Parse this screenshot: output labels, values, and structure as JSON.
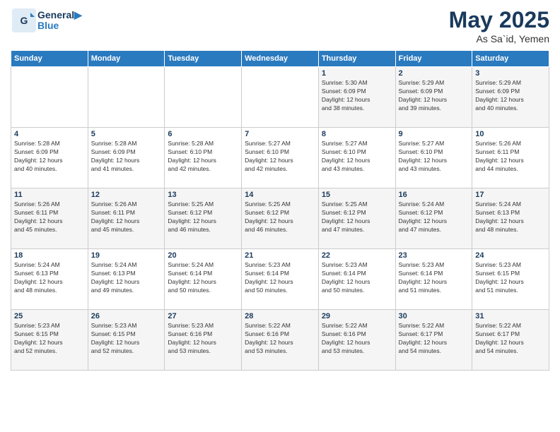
{
  "header": {
    "logo_line1": "General",
    "logo_line2": "Blue",
    "month": "May 2025",
    "location": "As Sa`id, Yemen"
  },
  "days_of_week": [
    "Sunday",
    "Monday",
    "Tuesday",
    "Wednesday",
    "Thursday",
    "Friday",
    "Saturday"
  ],
  "weeks": [
    [
      {
        "day": "",
        "content": ""
      },
      {
        "day": "",
        "content": ""
      },
      {
        "day": "",
        "content": ""
      },
      {
        "day": "",
        "content": ""
      },
      {
        "day": "1",
        "content": "Sunrise: 5:30 AM\nSunset: 6:09 PM\nDaylight: 12 hours\nand 38 minutes."
      },
      {
        "day": "2",
        "content": "Sunrise: 5:29 AM\nSunset: 6:09 PM\nDaylight: 12 hours\nand 39 minutes."
      },
      {
        "day": "3",
        "content": "Sunrise: 5:29 AM\nSunset: 6:09 PM\nDaylight: 12 hours\nand 40 minutes."
      }
    ],
    [
      {
        "day": "4",
        "content": "Sunrise: 5:28 AM\nSunset: 6:09 PM\nDaylight: 12 hours\nand 40 minutes."
      },
      {
        "day": "5",
        "content": "Sunrise: 5:28 AM\nSunset: 6:09 PM\nDaylight: 12 hours\nand 41 minutes."
      },
      {
        "day": "6",
        "content": "Sunrise: 5:28 AM\nSunset: 6:10 PM\nDaylight: 12 hours\nand 42 minutes."
      },
      {
        "day": "7",
        "content": "Sunrise: 5:27 AM\nSunset: 6:10 PM\nDaylight: 12 hours\nand 42 minutes."
      },
      {
        "day": "8",
        "content": "Sunrise: 5:27 AM\nSunset: 6:10 PM\nDaylight: 12 hours\nand 43 minutes."
      },
      {
        "day": "9",
        "content": "Sunrise: 5:27 AM\nSunset: 6:10 PM\nDaylight: 12 hours\nand 43 minutes."
      },
      {
        "day": "10",
        "content": "Sunrise: 5:26 AM\nSunset: 6:11 PM\nDaylight: 12 hours\nand 44 minutes."
      }
    ],
    [
      {
        "day": "11",
        "content": "Sunrise: 5:26 AM\nSunset: 6:11 PM\nDaylight: 12 hours\nand 45 minutes."
      },
      {
        "day": "12",
        "content": "Sunrise: 5:26 AM\nSunset: 6:11 PM\nDaylight: 12 hours\nand 45 minutes."
      },
      {
        "day": "13",
        "content": "Sunrise: 5:25 AM\nSunset: 6:12 PM\nDaylight: 12 hours\nand 46 minutes."
      },
      {
        "day": "14",
        "content": "Sunrise: 5:25 AM\nSunset: 6:12 PM\nDaylight: 12 hours\nand 46 minutes."
      },
      {
        "day": "15",
        "content": "Sunrise: 5:25 AM\nSunset: 6:12 PM\nDaylight: 12 hours\nand 47 minutes."
      },
      {
        "day": "16",
        "content": "Sunrise: 5:24 AM\nSunset: 6:12 PM\nDaylight: 12 hours\nand 47 minutes."
      },
      {
        "day": "17",
        "content": "Sunrise: 5:24 AM\nSunset: 6:13 PM\nDaylight: 12 hours\nand 48 minutes."
      }
    ],
    [
      {
        "day": "18",
        "content": "Sunrise: 5:24 AM\nSunset: 6:13 PM\nDaylight: 12 hours\nand 48 minutes."
      },
      {
        "day": "19",
        "content": "Sunrise: 5:24 AM\nSunset: 6:13 PM\nDaylight: 12 hours\nand 49 minutes."
      },
      {
        "day": "20",
        "content": "Sunrise: 5:24 AM\nSunset: 6:14 PM\nDaylight: 12 hours\nand 50 minutes."
      },
      {
        "day": "21",
        "content": "Sunrise: 5:23 AM\nSunset: 6:14 PM\nDaylight: 12 hours\nand 50 minutes."
      },
      {
        "day": "22",
        "content": "Sunrise: 5:23 AM\nSunset: 6:14 PM\nDaylight: 12 hours\nand 50 minutes."
      },
      {
        "day": "23",
        "content": "Sunrise: 5:23 AM\nSunset: 6:14 PM\nDaylight: 12 hours\nand 51 minutes."
      },
      {
        "day": "24",
        "content": "Sunrise: 5:23 AM\nSunset: 6:15 PM\nDaylight: 12 hours\nand 51 minutes."
      }
    ],
    [
      {
        "day": "25",
        "content": "Sunrise: 5:23 AM\nSunset: 6:15 PM\nDaylight: 12 hours\nand 52 minutes."
      },
      {
        "day": "26",
        "content": "Sunrise: 5:23 AM\nSunset: 6:15 PM\nDaylight: 12 hours\nand 52 minutes."
      },
      {
        "day": "27",
        "content": "Sunrise: 5:23 AM\nSunset: 6:16 PM\nDaylight: 12 hours\nand 53 minutes."
      },
      {
        "day": "28",
        "content": "Sunrise: 5:22 AM\nSunset: 6:16 PM\nDaylight: 12 hours\nand 53 minutes."
      },
      {
        "day": "29",
        "content": "Sunrise: 5:22 AM\nSunset: 6:16 PM\nDaylight: 12 hours\nand 53 minutes."
      },
      {
        "day": "30",
        "content": "Sunrise: 5:22 AM\nSunset: 6:17 PM\nDaylight: 12 hours\nand 54 minutes."
      },
      {
        "day": "31",
        "content": "Sunrise: 5:22 AM\nSunset: 6:17 PM\nDaylight: 12 hours\nand 54 minutes."
      }
    ]
  ]
}
